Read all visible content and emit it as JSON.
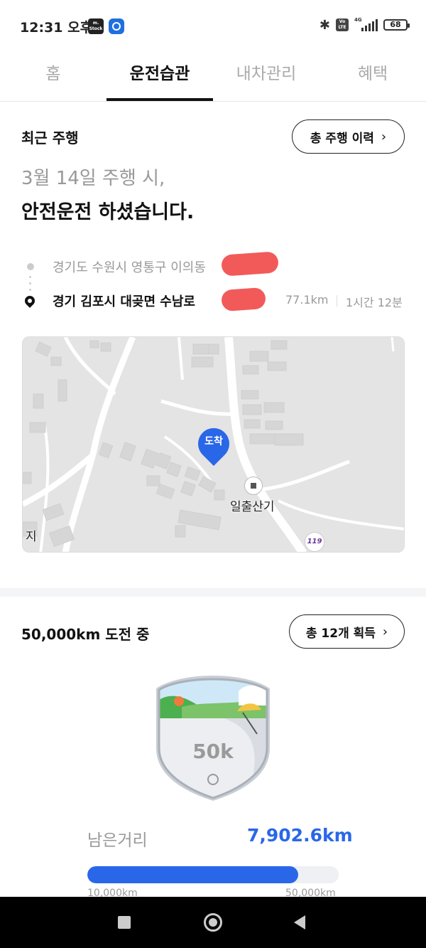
{
  "status_bar": {
    "time": "12:31 오후",
    "app_badge_label": "m.Stock",
    "volte": "Vo LTE",
    "network": "4G",
    "battery": "68"
  },
  "tabs": [
    {
      "label": "홈",
      "active": false
    },
    {
      "label": "운전습관",
      "active": true
    },
    {
      "label": "내차관리",
      "active": false
    },
    {
      "label": "혜택",
      "active": false
    }
  ],
  "recent_drive": {
    "title": "최근 주행",
    "history_button": "총 주행 이력",
    "date_line": "3월 14일 주행 시,",
    "message": "안전운전 하셨습니다.",
    "origin": "경기도 수원시 영통구 이의동",
    "destination": "경기 김포시 대곶면 수남로",
    "distance": "77.1km",
    "duration": "1시간 12분",
    "redaction_color": "#f25a5a"
  },
  "map": {
    "arrival_marker": "도착",
    "poi_label": "일출산기",
    "edge_label": "지",
    "fire_station_badge": "119",
    "marker_color": "#2a67e8"
  },
  "challenge": {
    "title": "50,000km 도전 중",
    "acquired_button": "총 12개 획득",
    "badge_text": "50k",
    "remaining_label": "남은거리",
    "remaining_value": "7,902.6km",
    "progress_fraction": 0.84,
    "progress_min": "10,000km",
    "progress_max": "50,000km",
    "accent_color": "#2a67e8"
  },
  "nav_bar": {
    "recent_icon": "square-icon",
    "home_icon": "circle-icon",
    "back_icon": "triangle-back-icon"
  }
}
